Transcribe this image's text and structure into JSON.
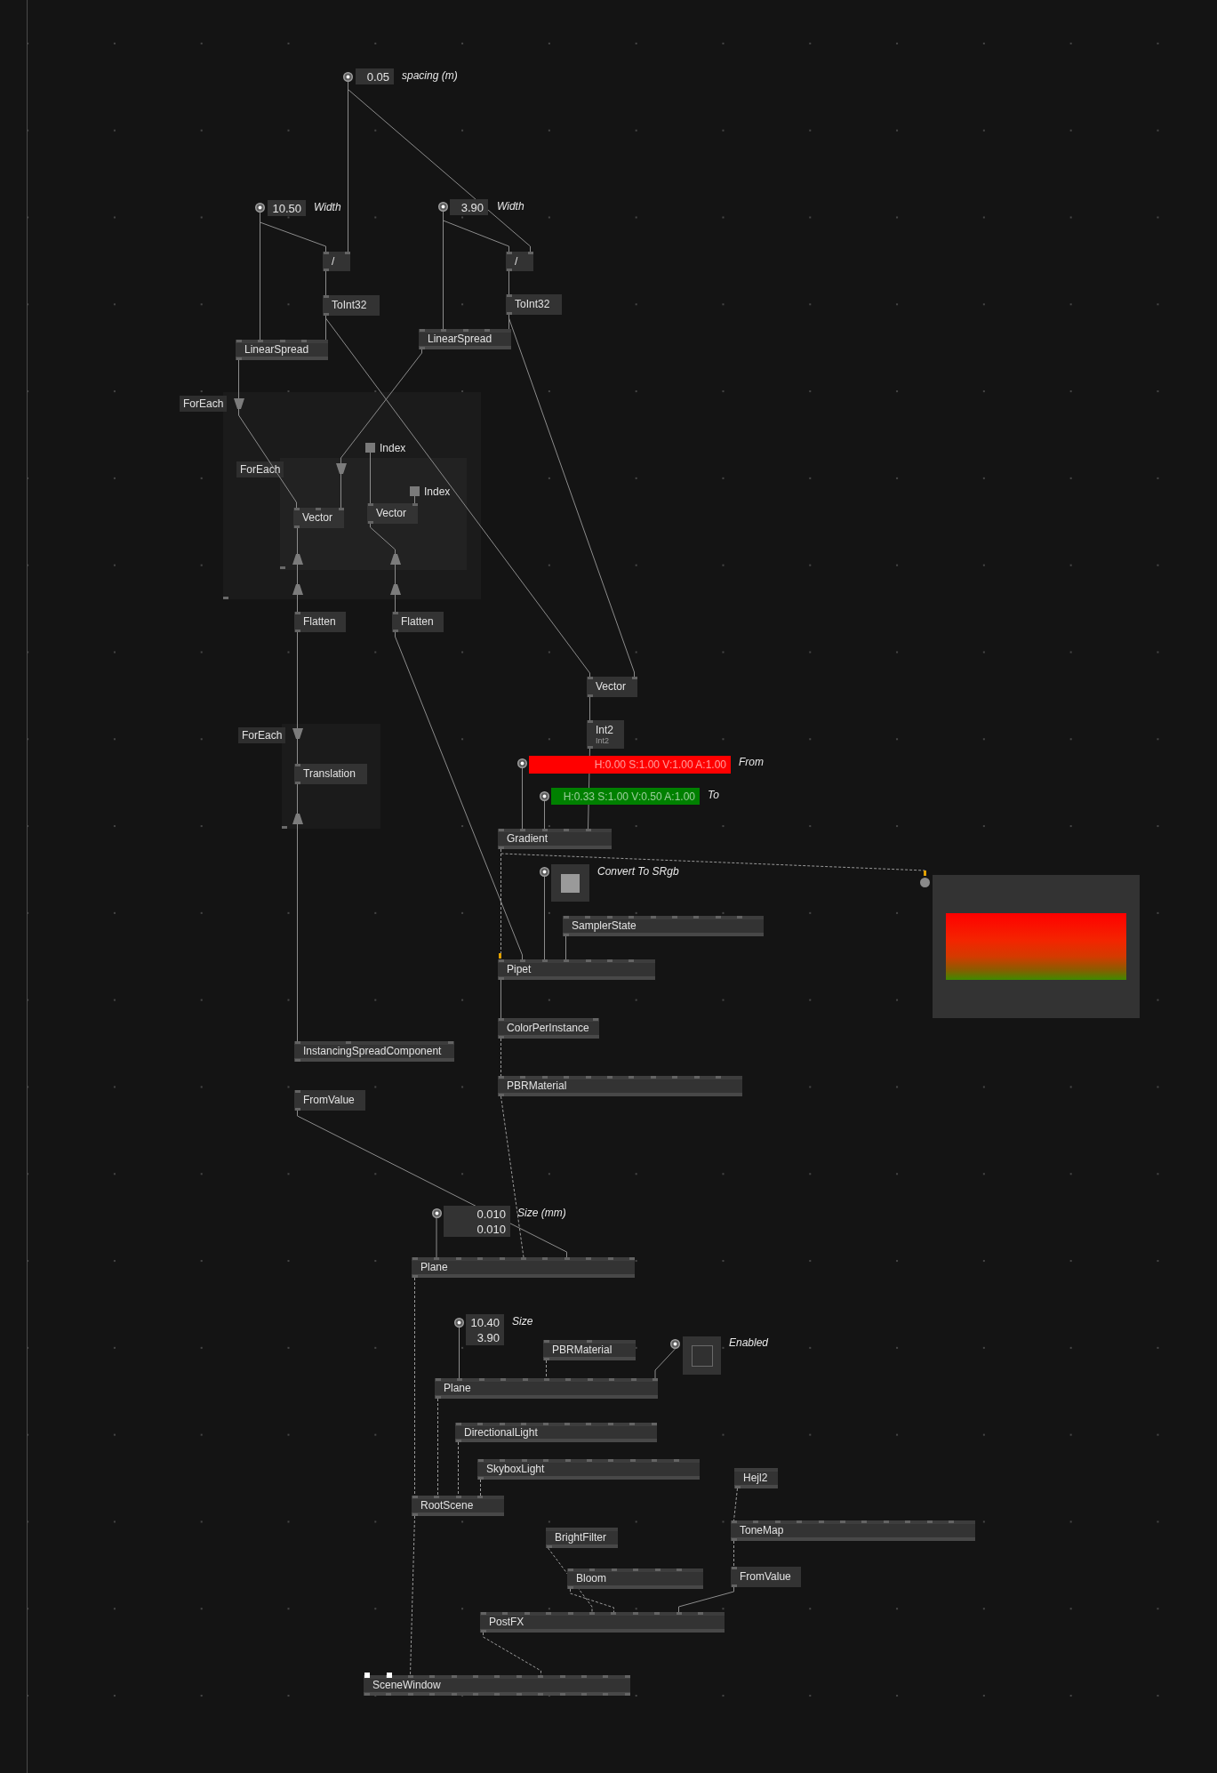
{
  "nodes": [
    {
      "label": "/"
    },
    {
      "label": "/"
    },
    {
      "label": "ToInt32"
    },
    {
      "label": "ToInt32"
    },
    {
      "label": "LinearSpread"
    },
    {
      "label": "LinearSpread"
    },
    {
      "label": "Vector"
    },
    {
      "label": "Vector"
    },
    {
      "label": "Flatten"
    },
    {
      "label": "Flatten"
    },
    {
      "label": "Vector"
    },
    {
      "label": "Int2",
      "subtitle": "Int2"
    },
    {
      "label": "Translation"
    },
    {
      "label": "Gradient"
    },
    {
      "label": "SamplerState"
    },
    {
      "label": "Pipet"
    },
    {
      "label": "ColorPerInstance"
    },
    {
      "label": "InstancingSpreadComponent"
    },
    {
      "label": "PBRMaterial"
    },
    {
      "label": "FromValue"
    },
    {
      "label": "Plane"
    },
    {
      "label": "PBRMaterial"
    },
    {
      "label": "Plane"
    },
    {
      "label": "DirectionalLight"
    },
    {
      "label": "SkyboxLight"
    },
    {
      "label": "Hejl2"
    },
    {
      "label": "RootScene"
    },
    {
      "label": "ToneMap"
    },
    {
      "label": "BrightFilter"
    },
    {
      "label": "FromValue"
    },
    {
      "label": "Bloom"
    },
    {
      "label": "PostFX"
    },
    {
      "label": "SceneWindow"
    }
  ],
  "value_boxes": [
    {
      "values": [
        "0.05"
      ],
      "label": "spacing (m)"
    },
    {
      "values": [
        "10.50"
      ],
      "label": "Width"
    },
    {
      "values": [
        "3.90"
      ],
      "label": "Width"
    },
    {
      "values": [
        "0.010",
        "0.010"
      ],
      "label": "Size (mm)"
    },
    {
      "values": [
        "10.40",
        "3.90"
      ],
      "label": "Size"
    }
  ],
  "color_boxes": [
    {
      "value": "H:0.00 S:1.00 V:1.00 A:1.00",
      "color": "#ff0000",
      "label": "From"
    },
    {
      "value": "H:0.33 S:1.00 V:0.50 A:1.00",
      "color": "#008000",
      "label": "To"
    }
  ],
  "toggles": [
    {
      "label": "Convert To SRgb",
      "checked": true
    },
    {
      "label": "Enabled",
      "checked": false
    }
  ],
  "regions": [
    {
      "label": "ForEach"
    },
    {
      "label": "ForEach"
    },
    {
      "label": "ForEach"
    }
  ],
  "index_pins": [
    {
      "label": "Index"
    },
    {
      "label": "Index"
    }
  ]
}
